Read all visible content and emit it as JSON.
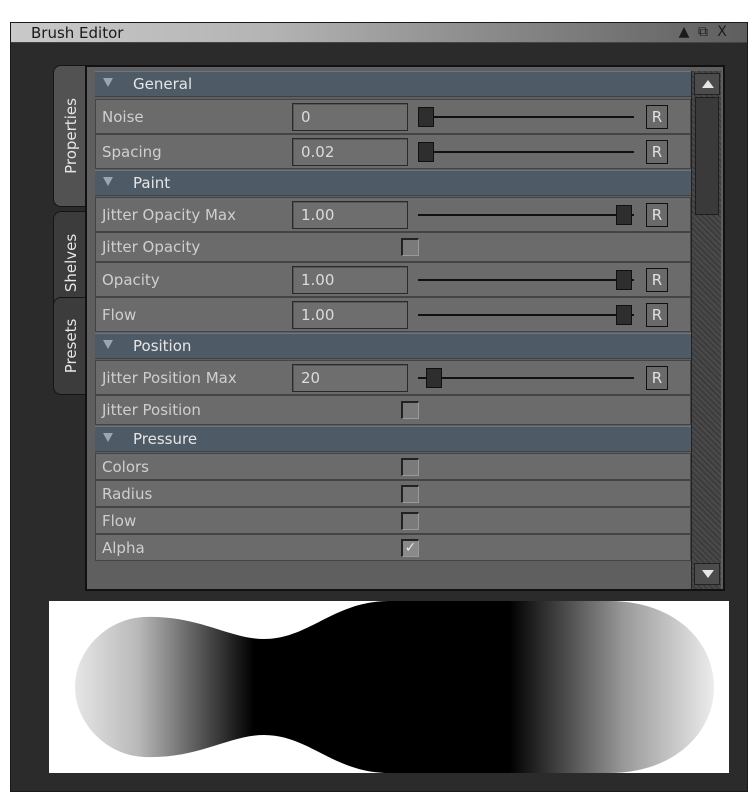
{
  "window": {
    "title": "Brush Editor",
    "title_buttons": [
      "▲",
      "⧉",
      "X"
    ]
  },
  "tabs": [
    {
      "label": "Properties",
      "active": true
    },
    {
      "label": "Shelves",
      "active": false
    },
    {
      "label": "Presets",
      "active": false
    }
  ],
  "sections": {
    "general": "General",
    "paint": "Paint",
    "position": "Position",
    "pressure": "Pressure"
  },
  "rows": {
    "noise": {
      "label": "Noise",
      "value": "0",
      "slider": 0.0,
      "reset": "R"
    },
    "spacing": {
      "label": "Spacing",
      "value": "0.02",
      "slider": 0.0,
      "reset": "R"
    },
    "jitter_opacity_max": {
      "label": "Jitter Opacity Max",
      "value": "1.00",
      "slider": 1.0,
      "reset": "R"
    },
    "jitter_opacity": {
      "label": "Jitter Opacity",
      "checked": false
    },
    "opacity": {
      "label": "Opacity",
      "value": "1.00",
      "slider": 1.0,
      "reset": "R"
    },
    "flow": {
      "label": "Flow",
      "value": "1.00",
      "slider": 1.0,
      "reset": "R"
    },
    "jitter_position_max": {
      "label": "Jitter Position Max",
      "value": "20",
      "slider": 0.04,
      "reset": "R"
    },
    "jitter_position": {
      "label": "Jitter Position",
      "checked": false
    },
    "pressure_colors": {
      "label": "Colors",
      "checked": false
    },
    "pressure_radius": {
      "label": "Radius",
      "checked": false
    },
    "pressure_flow": {
      "label": "Flow",
      "checked": false
    },
    "pressure_alpha": {
      "label": "Alpha",
      "checked": true,
      "checkmark": "✓"
    }
  },
  "colors": {
    "window_bg": "#2b2b2b",
    "section_header": "#4e5a66",
    "row_bg": "#6b6b6b"
  },
  "icons": [
    "triangle-down-icon",
    "scroll-up-icon",
    "scroll-down-icon",
    "checkmark-icon"
  ]
}
